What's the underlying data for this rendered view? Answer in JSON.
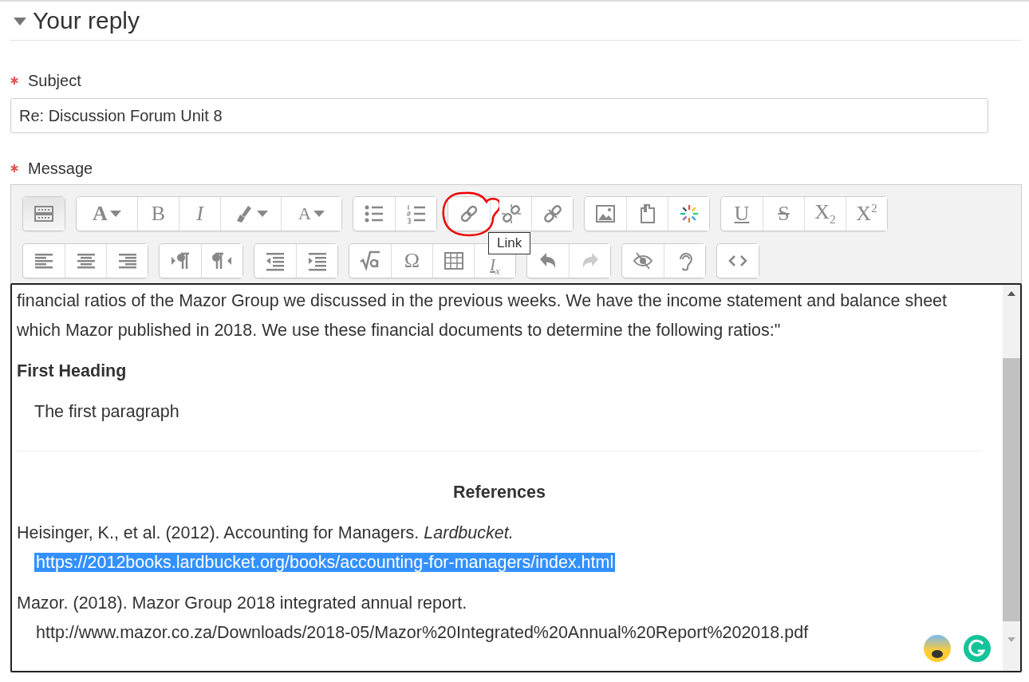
{
  "section": {
    "title": "Your reply",
    "expanded": true
  },
  "fields": [
    {
      "label": "Subject",
      "required": true,
      "value": "Re: Discussion Forum Unit 8"
    },
    {
      "label": "Message",
      "required": true
    }
  ],
  "toolbar": {
    "rows": [
      [
        [
          {
            "kind": "more",
            "pressed": true,
            "disabled": false,
            "circled": false
          }
        ],
        [
          {
            "kind": "font",
            "label": "A",
            "pressed": false,
            "disabled": false,
            "circled": false
          },
          {
            "kind": "bold",
            "label": "B",
            "pressed": false,
            "disabled": false,
            "circled": false
          },
          {
            "kind": "italic",
            "label": "I",
            "pressed": false,
            "disabled": false,
            "circled": false
          },
          {
            "kind": "highlight",
            "pressed": false,
            "disabled": false,
            "circled": false
          },
          {
            "kind": "color",
            "label": "A",
            "pressed": false,
            "disabled": false,
            "circled": false
          }
        ],
        [
          {
            "kind": "bullets",
            "pressed": false,
            "disabled": false,
            "circled": false
          },
          {
            "kind": "numbers",
            "pressed": false,
            "disabled": false,
            "circled": false
          }
        ],
        [
          {
            "kind": "link",
            "pressed": false,
            "disabled": false,
            "circled": true,
            "tooltip": "Link"
          },
          {
            "kind": "unlink",
            "pressed": false,
            "disabled": false,
            "circled": false
          },
          {
            "kind": "autolink",
            "pressed": false,
            "disabled": false,
            "circled": false
          }
        ],
        [
          {
            "kind": "image",
            "pressed": false,
            "disabled": false,
            "circled": false
          },
          {
            "kind": "file",
            "pressed": false,
            "disabled": false,
            "circled": false
          },
          {
            "kind": "sparkle",
            "pressed": false,
            "disabled": false,
            "circled": false
          }
        ],
        [
          {
            "kind": "underline",
            "label": "U",
            "pressed": false,
            "disabled": false,
            "circled": false
          },
          {
            "kind": "strike",
            "label": "S",
            "pressed": false,
            "disabled": false,
            "circled": false
          },
          {
            "kind": "sub",
            "label": "X",
            "sub_label": "2",
            "pressed": false,
            "disabled": false,
            "circled": false
          },
          {
            "kind": "sup",
            "label": "X",
            "sup_label": "2",
            "pressed": false,
            "disabled": false,
            "circled": false
          }
        ]
      ],
      [
        [
          {
            "kind": "align-left",
            "pressed": false,
            "disabled": false,
            "circled": false
          },
          {
            "kind": "align-center",
            "pressed": false,
            "disabled": false,
            "circled": false
          },
          {
            "kind": "align-right",
            "pressed": false,
            "disabled": false,
            "circled": false
          }
        ],
        [
          {
            "kind": "ltr",
            "pressed": false,
            "disabled": false,
            "circled": false
          },
          {
            "kind": "rtl",
            "pressed": false,
            "disabled": false,
            "circled": false
          }
        ],
        [
          {
            "kind": "outdent",
            "pressed": false,
            "disabled": false,
            "circled": false
          },
          {
            "kind": "indent",
            "pressed": false,
            "disabled": false,
            "circled": false
          }
        ],
        [
          {
            "kind": "equation",
            "pressed": false,
            "disabled": false,
            "circled": false
          },
          {
            "kind": "omega",
            "label": "Ω",
            "pressed": false,
            "disabled": false,
            "circled": false
          },
          {
            "kind": "table",
            "pressed": false,
            "disabled": false,
            "circled": false
          },
          {
            "kind": "clear",
            "label": "I",
            "sub_label": "x",
            "pressed": false,
            "disabled": false,
            "circled": false
          }
        ],
        [
          {
            "kind": "undo",
            "pressed": false,
            "disabled": false,
            "circled": false
          },
          {
            "kind": "redo",
            "pressed": false,
            "disabled": true,
            "circled": false
          }
        ],
        [
          {
            "kind": "accessibility",
            "pressed": false,
            "disabled": false,
            "circled": false
          },
          {
            "kind": "screenreader",
            "pressed": false,
            "disabled": false,
            "circled": false
          }
        ],
        [
          {
            "kind": "html",
            "pressed": false,
            "disabled": false,
            "circled": false
          }
        ]
      ]
    ]
  },
  "content": [
    {
      "kind": "text",
      "text": "financial ratios of the Mazor Group we discussed in the previous weeks. We have the income statement and balance sheet which Mazor published in 2018. We use these financial documents to determine the following ratios:\""
    },
    {
      "kind": "heading",
      "text": "First Heading"
    },
    {
      "kind": "indented",
      "text": "The first paragraph"
    },
    {
      "kind": "divider"
    },
    {
      "kind": "centered-heading",
      "text": "References"
    },
    {
      "kind": "reference",
      "text": "Heisinger, K., et al. (2012). Accounting for Managers. *Lardbucket.*",
      "url": "https://2012books.lardbucket.org/books/accounting-for-managers/index.html",
      "selected": true
    },
    {
      "kind": "reference",
      "text": "Mazor. (2018). Mazor Group 2018 integrated annual report.",
      "url": "http://www.mazor.co.za/Downloads/2018-05/Mazor%20Integrated%20Annual%20Report%202018.pdf",
      "selected": false
    }
  ]
}
